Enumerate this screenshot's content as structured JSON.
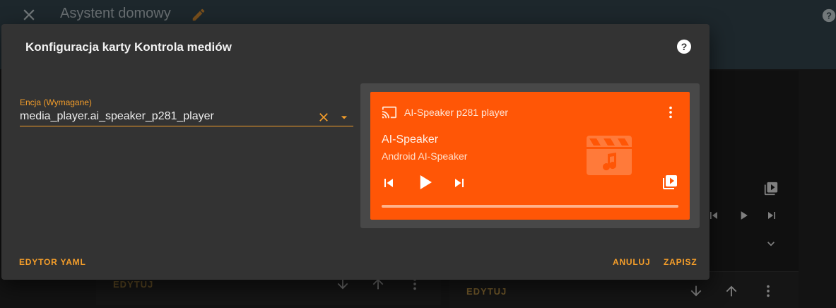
{
  "app": {
    "title": "Asystent domowy"
  },
  "background": {
    "edit_label": "EDYTUJ"
  },
  "dialog": {
    "title": "Konfiguracja karty Kontrola mediów",
    "entity_field": {
      "label": "Encja (Wymagane)",
      "value": "media_player.ai_speaker_p281_player"
    },
    "buttons": {
      "yaml": "EDYTOR YAML",
      "cancel": "ANULUJ",
      "save": "ZAPISZ"
    }
  },
  "media_card": {
    "player_name": "AI-Speaker p281 player",
    "media_title": "AI-Speaker",
    "media_artist": "Android AI-Speaker",
    "progress": 1.0
  },
  "colors": {
    "accent": "#f59e2a",
    "card": "#ff5606",
    "dialog": "#333333",
    "header": "#2b3a41"
  },
  "icons": [
    "close-icon",
    "pencil-icon",
    "help-icon",
    "cast-icon",
    "more-vert-icon",
    "movie-icon",
    "skip-previous-icon",
    "play-icon",
    "skip-next-icon",
    "playlist-play-icon",
    "arrow-down-icon",
    "arrow-up-icon",
    "chevron-down-icon",
    "clear-icon",
    "dropdown-icon"
  ]
}
